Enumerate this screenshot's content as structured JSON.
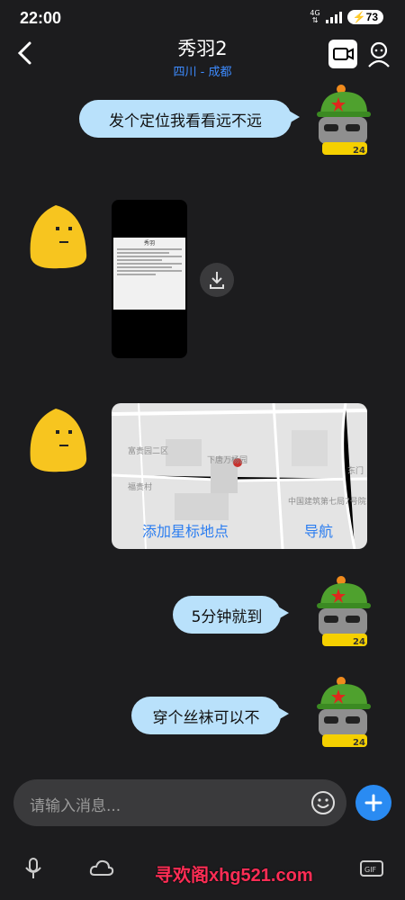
{
  "status_bar": {
    "time": "22:00",
    "network": "4G",
    "battery": "73"
  },
  "header": {
    "title": "秀羽2",
    "subtitle": "四川 - 成都"
  },
  "messages": {
    "m1": "发个定位我看看远不远",
    "image_doc": {
      "title": "秀羽"
    },
    "map": {
      "labels": [
        "富贵园二区",
        "下唐万杨园",
        "中国建筑第七局7号院",
        "福贵村",
        "东门"
      ],
      "add_star": "添加星标地点",
      "navigate": "导航"
    },
    "m2": "5分钟就到",
    "m3": "穿个丝袜可以不"
  },
  "input": {
    "placeholder": "请输入消息..."
  },
  "watermark": "寻欢阁xhg521.com",
  "icons": [
    "back-arrow-icon",
    "video-call-icon",
    "user-icon",
    "download-icon",
    "emoji-icon",
    "plus-icon",
    "mic-icon",
    "cloud-icon",
    "gif-icon"
  ],
  "colors": {
    "bubble": "#b9e1fb",
    "accent": "#2a8bf2",
    "background": "#1c1c1e"
  }
}
